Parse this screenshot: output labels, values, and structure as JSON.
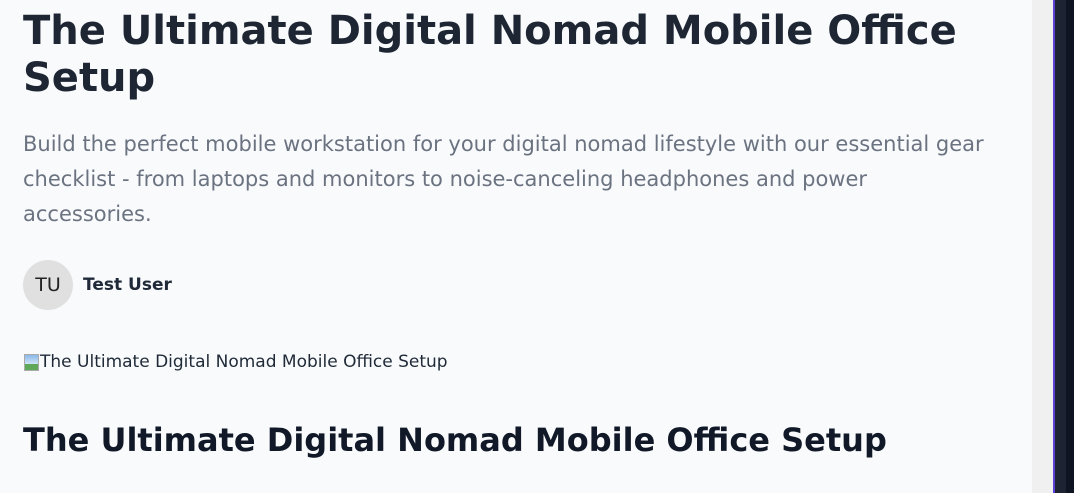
{
  "article": {
    "title": "The Ultimate Digital Nomad Mobile Office Setup",
    "subtitle": "Build the perfect mobile workstation for your digital nomad lifestyle with our essential gear checklist - from laptops and monitors to noise-canceling headphones and power accessories.",
    "author": {
      "initials": "TU",
      "name": "Test User"
    },
    "hero_image_alt": "The Ultimate Digital Nomad Mobile Office Setup",
    "section_heading": "The Ultimate Digital Nomad Mobile Office Setup"
  },
  "colors": {
    "accent": "#5b3fd6",
    "background": "#f8fafc"
  }
}
